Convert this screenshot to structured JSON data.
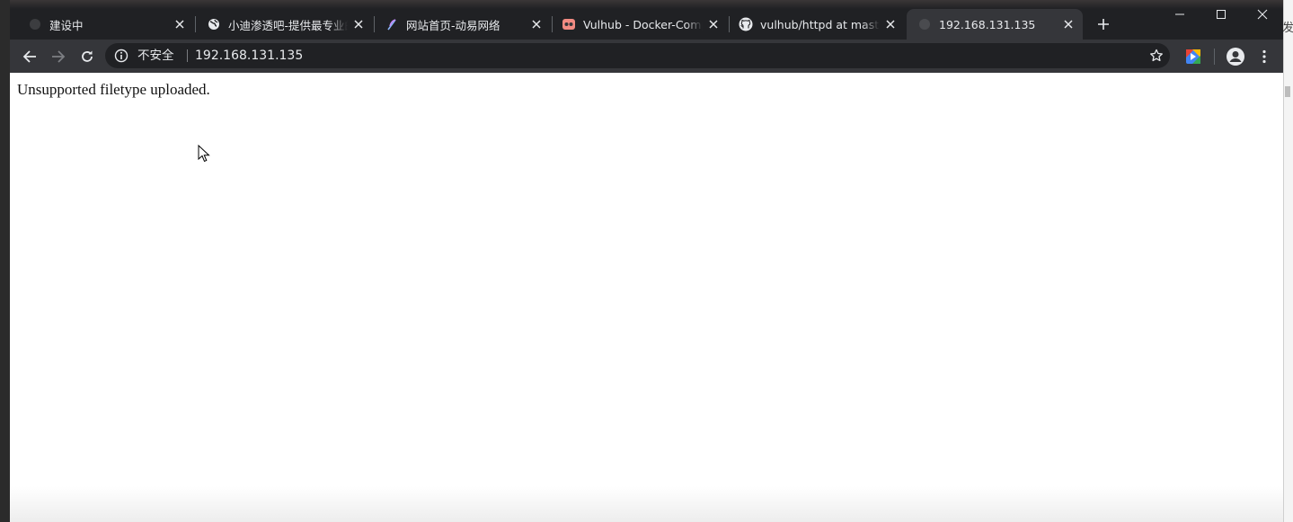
{
  "tabs": [
    {
      "title": "建设中",
      "favicon": "loading-globe-icon",
      "active": false
    },
    {
      "title": "小迪渗透吧-提供最专业的",
      "favicon": "globe-icon",
      "active": false
    },
    {
      "title": "网站首页-动易网络",
      "favicon": "feather-icon",
      "active": false
    },
    {
      "title": "Vulhub - Docker-Compose",
      "favicon": "vulhub-icon",
      "active": false
    },
    {
      "title": "vulhub/httpd at master",
      "favicon": "github-icon",
      "active": false
    },
    {
      "title": "192.168.131.135",
      "favicon": "loading-globe-icon",
      "active": true
    }
  ],
  "omnibox": {
    "security_label": "不安全",
    "url": "192.168.131.135"
  },
  "page": {
    "message": "Unsupported filetype uploaded."
  },
  "desktop": {
    "right_glyph": "发"
  },
  "colors": {
    "tabstrip": "#202124",
    "toolbar": "#35363a",
    "omnibox": "#202124",
    "text": "#e8eaed"
  }
}
